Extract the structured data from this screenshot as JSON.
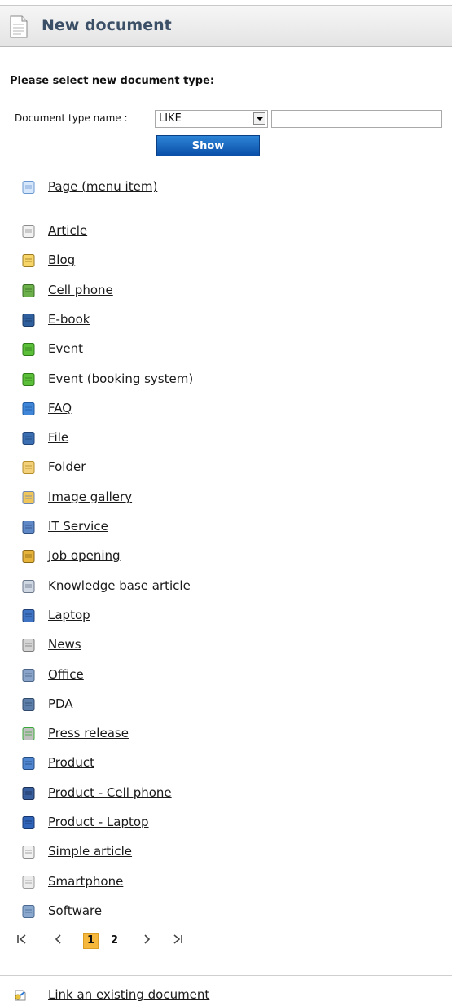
{
  "header": {
    "title": "New document"
  },
  "subtitle": "Please select new document type:",
  "filter": {
    "label": "Document type name :",
    "operator": "LIKE",
    "value": "",
    "button": "Show"
  },
  "page_item": {
    "label": "Page (menu item)",
    "icon": "page-icon"
  },
  "items": [
    {
      "label": "Article",
      "icon": "article-icon"
    },
    {
      "label": "Blog",
      "icon": "blog-icon"
    },
    {
      "label": "Cell phone",
      "icon": "cell-phone-icon"
    },
    {
      "label": "E-book",
      "icon": "ebook-icon"
    },
    {
      "label": "Event",
      "icon": "flag-icon"
    },
    {
      "label": "Event (booking system)",
      "icon": "booking-flag-icon"
    },
    {
      "label": "FAQ",
      "icon": "help-icon"
    },
    {
      "label": "File",
      "icon": "floppy-icon"
    },
    {
      "label": "Folder",
      "icon": "folder-icon"
    },
    {
      "label": "Image gallery",
      "icon": "image-gallery-icon"
    },
    {
      "label": "IT Service",
      "icon": "computer-icon"
    },
    {
      "label": "Job opening",
      "icon": "person-icon"
    },
    {
      "label": "Knowledge base article",
      "icon": "book-icon"
    },
    {
      "label": "Laptop",
      "icon": "laptop-icon"
    },
    {
      "label": "News",
      "icon": "news-icon"
    },
    {
      "label": "Office",
      "icon": "office-icon"
    },
    {
      "label": "PDA",
      "icon": "pda-icon"
    },
    {
      "label": "Press release",
      "icon": "press-release-icon"
    },
    {
      "label": "Product",
      "icon": "product-icon"
    },
    {
      "label": "Product - Cell phone",
      "icon": "product-cell-phone-icon"
    },
    {
      "label": "Product - Laptop",
      "icon": "product-laptop-icon"
    },
    {
      "label": "Simple article",
      "icon": "simple-article-icon"
    },
    {
      "label": "Smartphone",
      "icon": "smartphone-icon"
    },
    {
      "label": "Software",
      "icon": "software-icon"
    }
  ],
  "pager": {
    "first": "|<",
    "prev": "<",
    "pages": [
      "1",
      "2"
    ],
    "current": "1",
    "next": ">",
    "last": ">|"
  },
  "link_existing": {
    "label": "Link an existing document",
    "icon": "link-document-icon"
  }
}
